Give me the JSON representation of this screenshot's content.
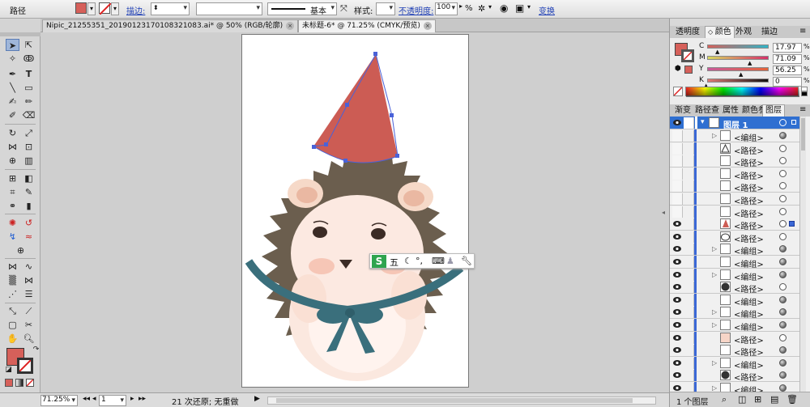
{
  "control_bar": {
    "object_type": "路径",
    "fill_color": "#d6605a",
    "stroke_label": "描边:",
    "stroke_profile": "基本",
    "style_label": "样式:",
    "opacity_label": "不透明度:",
    "opacity_value": "100",
    "opacity_unit": "%",
    "transform_label": "变换"
  },
  "doc_tabs": [
    {
      "label": "Nipic_21255351_20190123170108321083.ai* @ 50% (RGB/轮廓)",
      "close": "×"
    },
    {
      "label": "未标题-6* @ 71.25% (CMYK/预览)",
      "close": "×"
    }
  ],
  "ime_toolbar": {
    "logo": "S",
    "mode": "五",
    "icons": [
      "moon-icon",
      "punct-icon",
      "keyboard-icon",
      "skin-icon",
      "wrench-icon"
    ]
  },
  "status_bar": {
    "zoom": "71.25%",
    "page": "1",
    "status_text": "21 次还原; 无重做"
  },
  "color_panel": {
    "tabs": [
      "透明度",
      "颜色",
      "外观",
      "描边"
    ],
    "active_tab": 1,
    "channels": [
      {
        "label": "C",
        "value": "17.97",
        "fraction": 0.18,
        "gradient": "linear-gradient(90deg,#d6605a,#2fb5c8)"
      },
      {
        "label": "M",
        "value": "71.09",
        "fraction": 0.71,
        "gradient": "linear-gradient(90deg,#d6d860,#d6306a)"
      },
      {
        "label": "Y",
        "value": "56.25",
        "fraction": 0.56,
        "gradient": "linear-gradient(90deg,#c85a9a,#e4643a)"
      },
      {
        "label": "K",
        "value": "0",
        "fraction": 0.0,
        "gradient": "linear-gradient(90deg,#e07a74,#111)"
      }
    ],
    "unit": "%"
  },
  "layers_panel": {
    "tabs": [
      "渐变",
      "路径查",
      "属性",
      "颜色参",
      "图层"
    ],
    "active_tab": 4,
    "layer_name": "图层 1",
    "items": [
      {
        "name": "<编组>",
        "expand": true,
        "thumb": "blank",
        "eye": false,
        "target": "fill"
      },
      {
        "name": "<路径>",
        "expand": false,
        "thumb": "triangle",
        "eye": false,
        "target": "empty"
      },
      {
        "name": "<路径>",
        "expand": false,
        "thumb": "blank",
        "eye": false,
        "target": "empty"
      },
      {
        "name": "<路径>",
        "expand": false,
        "thumb": "blank",
        "eye": false,
        "target": "empty"
      },
      {
        "name": "<路径>",
        "expand": false,
        "thumb": "blank",
        "eye": false,
        "target": "empty"
      },
      {
        "name": "<路径>",
        "expand": false,
        "thumb": "blank",
        "eye": false,
        "target": "empty"
      },
      {
        "name": "<路径>",
        "expand": false,
        "thumb": "blank",
        "eye": false,
        "target": "empty"
      },
      {
        "name": "<路径>",
        "expand": false,
        "thumb": "hat",
        "eye": true,
        "target": "selected"
      },
      {
        "name": "<路径>",
        "expand": false,
        "thumb": "outline",
        "eye": true,
        "target": "empty"
      },
      {
        "name": "<编组>",
        "expand": true,
        "thumb": "blank",
        "eye": true,
        "target": "fill"
      },
      {
        "name": "<编组>",
        "expand": false,
        "thumb": "blank",
        "eye": true,
        "target": "fill"
      },
      {
        "name": "<编组>",
        "expand": true,
        "thumb": "blank",
        "eye": true,
        "target": "fill"
      },
      {
        "name": "<路径>",
        "expand": false,
        "thumb": "dark",
        "eye": true,
        "target": "empty"
      },
      {
        "name": "<编组>",
        "expand": false,
        "thumb": "blank",
        "eye": true,
        "target": "fill"
      },
      {
        "name": "<编组>",
        "expand": true,
        "thumb": "blank",
        "eye": true,
        "target": "fill"
      },
      {
        "name": "<编组>",
        "expand": true,
        "thumb": "blank",
        "eye": true,
        "target": "fill"
      },
      {
        "name": "<路径>",
        "expand": false,
        "thumb": "pink",
        "eye": true,
        "target": "empty"
      },
      {
        "name": "<路径>",
        "expand": false,
        "thumb": "blank",
        "eye": true,
        "target": "fill"
      },
      {
        "name": "<编组>",
        "expand": true,
        "thumb": "blank",
        "eye": true,
        "target": "fill"
      },
      {
        "name": "<路径>",
        "expand": false,
        "thumb": "dark",
        "eye": true,
        "target": "fill"
      },
      {
        "name": "<编组>",
        "expand": true,
        "thumb": "blank",
        "eye": true,
        "target": "fill"
      },
      {
        "name": "<路径>",
        "expand": false,
        "thumb": "blank",
        "eye": true,
        "target": "fill"
      }
    ],
    "footer_count": "1 个图层"
  }
}
